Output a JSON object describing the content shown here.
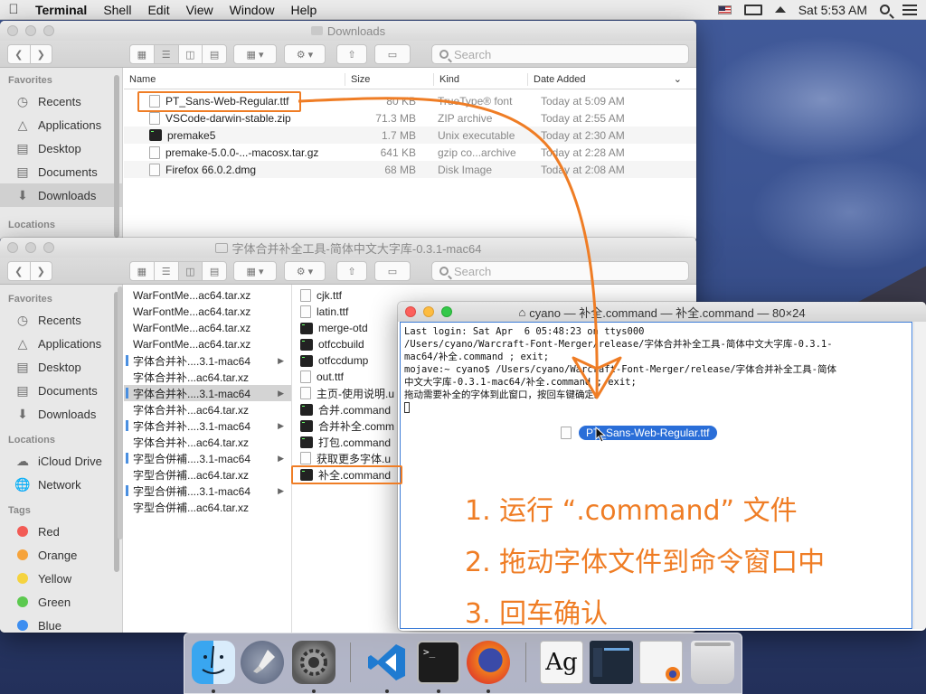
{
  "menubar": {
    "app_name": "Terminal",
    "items": [
      "Shell",
      "Edit",
      "View",
      "Window",
      "Help"
    ],
    "clock": "Sat 5:53 AM"
  },
  "finder_top": {
    "title": "Downloads",
    "search_placeholder": "Search",
    "columns": {
      "name": "Name",
      "size": "Size",
      "kind": "Kind",
      "date": "Date Added"
    },
    "files": [
      {
        "name": "PT_Sans-Web-Regular.ttf",
        "size": "80 KB",
        "kind": "TrueType® font",
        "date": "Today at 5:09 AM",
        "icon": "doc"
      },
      {
        "name": "VSCode-darwin-stable.zip",
        "size": "71.3 MB",
        "kind": "ZIP archive",
        "date": "Today at 2:55 AM",
        "icon": "doc"
      },
      {
        "name": "premake5",
        "size": "1.7 MB",
        "kind": "Unix executable",
        "date": "Today at 2:30 AM",
        "icon": "exec"
      },
      {
        "name": "premake-5.0.0-...-macosx.tar.gz",
        "size": "641 KB",
        "kind": "gzip co...archive",
        "date": "Today at 2:28 AM",
        "icon": "doc"
      },
      {
        "name": "Firefox 66.0.2.dmg",
        "size": "68 MB",
        "kind": "Disk Image",
        "date": "Today at 2:08 AM",
        "icon": "doc"
      }
    ],
    "sidebar": {
      "favorites_label": "Favorites",
      "items": [
        {
          "label": "Recents",
          "icon": "clock-icon"
        },
        {
          "label": "Applications",
          "icon": "applications-icon"
        },
        {
          "label": "Desktop",
          "icon": "desktop-icon"
        },
        {
          "label": "Documents",
          "icon": "documents-icon"
        },
        {
          "label": "Downloads",
          "icon": "downloads-icon",
          "selected": true
        }
      ],
      "locations_label": "Locations"
    }
  },
  "finder_bottom": {
    "title": "字体合并补全工具-简体中文大字库-0.3.1-mac64",
    "search_placeholder": "Search",
    "sidebar": {
      "favorites_label": "Favorites",
      "favorites": [
        {
          "label": "Recents",
          "icon": "clock-icon"
        },
        {
          "label": "Applications",
          "icon": "applications-icon"
        },
        {
          "label": "Desktop",
          "icon": "desktop-icon"
        },
        {
          "label": "Documents",
          "icon": "documents-icon"
        },
        {
          "label": "Downloads",
          "icon": "downloads-icon"
        }
      ],
      "locations_label": "Locations",
      "locations": [
        {
          "label": "iCloud Drive",
          "icon": "cloud-icon"
        },
        {
          "label": "Network",
          "icon": "network-icon"
        }
      ],
      "tags_label": "Tags",
      "tags": [
        {
          "label": "Red",
          "color": "#f25b55"
        },
        {
          "label": "Orange",
          "color": "#f6a33b"
        },
        {
          "label": "Yellow",
          "color": "#f5d33f"
        },
        {
          "label": "Green",
          "color": "#5cc94f"
        },
        {
          "label": "Blue",
          "color": "#3d8ef0"
        }
      ]
    },
    "column1": [
      {
        "name": "WarFontMe...ac64.tar.xz"
      },
      {
        "name": "WarFontMe...ac64.tar.xz"
      },
      {
        "name": "WarFontMe...ac64.tar.xz"
      },
      {
        "name": "WarFontMe...ac64.tar.xz"
      },
      {
        "name": "字体合并补....3.1-mac64",
        "folder": true
      },
      {
        "name": "字体合并补...ac64.tar.xz"
      },
      {
        "name": "字体合并补....3.1-mac64",
        "folder": true,
        "selected": true
      },
      {
        "name": "字体合并补...ac64.tar.xz"
      },
      {
        "name": "字体合并补....3.1-mac64",
        "folder": true
      },
      {
        "name": "字体合并补...ac64.tar.xz"
      },
      {
        "name": "字型合併補....3.1-mac64",
        "folder": true
      },
      {
        "name": "字型合併補...ac64.tar.xz"
      },
      {
        "name": "字型合併補....3.1-mac64",
        "folder": true
      },
      {
        "name": "字型合併補...ac64.tar.xz"
      }
    ],
    "column2": [
      {
        "name": "cjk.ttf",
        "icon": "doc"
      },
      {
        "name": "latin.ttf",
        "icon": "doc"
      },
      {
        "name": "merge-otd",
        "icon": "exec"
      },
      {
        "name": "otfccbuild",
        "icon": "exec"
      },
      {
        "name": "otfccdump",
        "icon": "exec"
      },
      {
        "name": "out.ttf",
        "icon": "doc"
      },
      {
        "name": "主页-使用说明.u",
        "icon": "doc"
      },
      {
        "name": "合并.command",
        "icon": "exec"
      },
      {
        "name": "合并补全.comm",
        "icon": "exec"
      },
      {
        "name": "打包.command",
        "icon": "exec"
      },
      {
        "name": "获取更多字体.u",
        "icon": "doc"
      },
      {
        "name": "补全.command",
        "icon": "exec",
        "highlighted": true
      }
    ]
  },
  "terminal": {
    "title": "cyano — 补全.command — 补全.command — 80×24",
    "lines": [
      "Last login: Sat Apr  6 05:48:23 on ttys000",
      "/Users/cyano/Warcraft-Font-Merger/release/字体合并补全工具-简体中文大字库-0.3.1-",
      "mac64/补全.command ; exit;",
      "mojave:~ cyano$ /Users/cyano/Warcraft-Font-Merger/release/字体合并补全工具-简体",
      "中文大字库-0.3.1-mac64/补全.command ; exit;",
      "拖动需要补全的字体到此窗口，按回车键确定。"
    ]
  },
  "drag_item": {
    "label": "PT_Sans-Web-Regular.ttf"
  },
  "instructions": [
    "1. 运行 “.command” 文件",
    "2. 拖动字体文件到命令窗口中",
    "3. 回车确认"
  ],
  "dock": {
    "apps": [
      "finder-icon",
      "launchpad-icon",
      "system-preferences-icon",
      "vscode-icon",
      "terminal-icon",
      "firefox-icon",
      "font-book-icon",
      "vscode-window-icon",
      "firefox-window-icon",
      "trash-icon"
    ],
    "font_book_glyph": "Ag"
  },
  "colors": {
    "accent_orange": "#ef7d25",
    "selection_blue": "#2a6ed8"
  }
}
